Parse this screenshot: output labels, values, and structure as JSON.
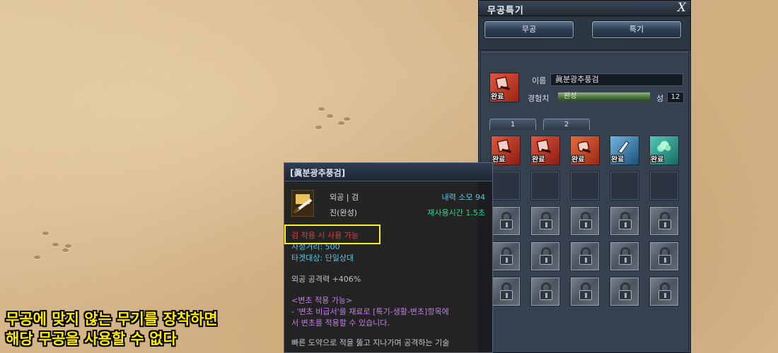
{
  "window": {
    "title": "무공특기",
    "close_label": "X",
    "tabs": [
      {
        "label": "무공"
      },
      {
        "label": "특기"
      }
    ]
  },
  "skill_detail": {
    "name_label": "이름",
    "name_value": "眞분광추풍검",
    "exp_label": "경험치",
    "exp_status": "완성",
    "exp_fill_percent": 100,
    "level_label": "성",
    "level_value": "12",
    "icon_badge": "완료"
  },
  "page_tabs": [
    {
      "label": "1"
    },
    {
      "label": "2"
    }
  ],
  "skill_slots": [
    {
      "icon": "sword-red-icon",
      "color": "#c83a2a",
      "badge": "완료"
    },
    {
      "icon": "sword-red-icon",
      "color": "#c83a2a",
      "badge": "완료"
    },
    {
      "icon": "fist-red-icon",
      "color": "#d0452e",
      "badge": "완료"
    },
    {
      "icon": "arrow-blue-icon",
      "color": "#4a93c8",
      "badge": "완료"
    },
    {
      "icon": "cloud-teal-icon",
      "color": "#35a8a0",
      "badge": "완료"
    }
  ],
  "tooltip": {
    "name": "[眞분광추풍검]",
    "type": "외공 | 검",
    "internal_cost": "내력 소모 94",
    "grade": "진(완성)",
    "cooldown": "재사용시간 1.5초",
    "requirement": "검 착용 시 사용 가능",
    "range": "사정거리: 500",
    "target": "타겟대상: 단일상대",
    "attack": "외공 공격력 +406%",
    "variant_title": "<변초 적용 가능>",
    "variant_line1": "- '변초 비급서'를 재료로 [특기-생활-변초]항목에",
    "variant_line2": "서 변초를 적용할 수 있습니다.",
    "description": "빠른 도약으로 적을 뚫고 지나가며 공격하는 기술"
  },
  "caption": {
    "line1": "무공에 맞지 않는 무기를 장착하면",
    "line2": "해당 무공을 사용할 수 없다"
  },
  "colors": {
    "caption": "#ffea00",
    "highlight_box": "#ffee22",
    "requirement_text": "#e23b3b",
    "cyan_text": "#5cc6df",
    "green_text": "#35d48c",
    "purple_text": "#c47be6"
  }
}
